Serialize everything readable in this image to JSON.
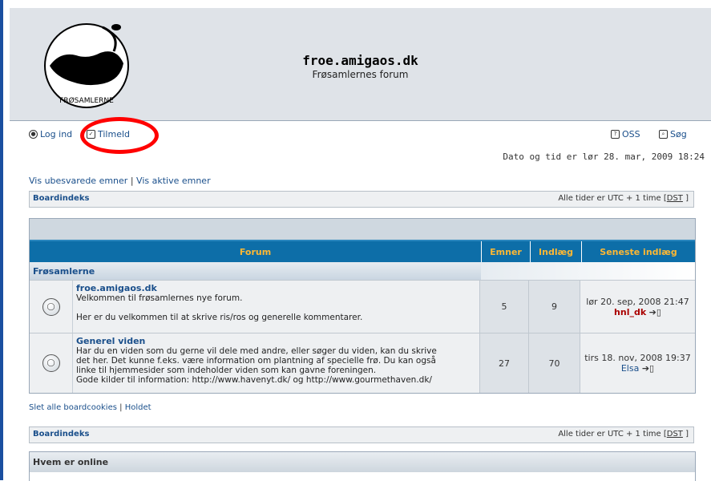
{
  "site": {
    "title": "froe.amigaos.dk",
    "subtitle": "Frøsamlernes forum",
    "logo_text": "FRØSAMLERNE"
  },
  "nav": {
    "login": "Log ind",
    "register": "Tilmeld",
    "faq": "OSS",
    "search": "Søg"
  },
  "datetime": "Dato og tid er lør 28. mar, 2009 18:24",
  "links": {
    "unanswered": "Vis ubesvarede emner",
    "separator": "|",
    "active": "Vis aktive emner"
  },
  "breadcrumb": {
    "label": "Boardindeks",
    "timezone_prefix": "Alle tider er UTC + 1 time [",
    "dst": "DST",
    "timezone_suffix": " ]"
  },
  "forum_table": {
    "headers": {
      "forum": "Forum",
      "topics": "Emner",
      "posts": "Indlæg",
      "last": "Seneste indlæg"
    },
    "category": "Frøsamlerne",
    "rows": [
      {
        "title": "froe.amigaos.dk",
        "desc1": "Velkommen til frøsamlernes nye forum.",
        "desc2": "",
        "desc3": "Her er du velkommen til at skrive ris/ros og generelle kommentarer.",
        "topics": "5",
        "posts": "9",
        "last_date": "lør 20. sep, 2008 21:47",
        "last_user": "hnl_dk"
      },
      {
        "title": "Generel viden",
        "desc1": "Har du en viden som du gerne vil dele med andre, eller søger du viden, kan du skrive",
        "desc2": "det her. Det kunne f.eks. være information om plantning af specielle frø. Du kan også",
        "desc3": "linke til hjemmesider som indeholder viden som kan gavne foreningen.",
        "desc4": "Gode kilder til information: http://www.havenyt.dk/ og http://www.gourmethaven.dk/",
        "topics": "27",
        "posts": "70",
        "last_date": "tirs 18. nov, 2008 19:37",
        "last_user": "Elsa"
      }
    ]
  },
  "bottom_links": {
    "delete_cookies": "Slet alle boardcookies",
    "separator": "|",
    "team": "Holdet"
  },
  "online": {
    "title": "Hvem er online"
  },
  "icons": [
    "login-icon",
    "register-icon",
    "faq-icon",
    "search-icon",
    "forum-folder-icon",
    "last-post-arrow-icon"
  ],
  "colors": {
    "header_bg": "#dfe3e8",
    "table_header": "#0d6ea8",
    "header_text": "#ffb833",
    "link": "#1a4f8b",
    "annotation": "#ff0000"
  }
}
